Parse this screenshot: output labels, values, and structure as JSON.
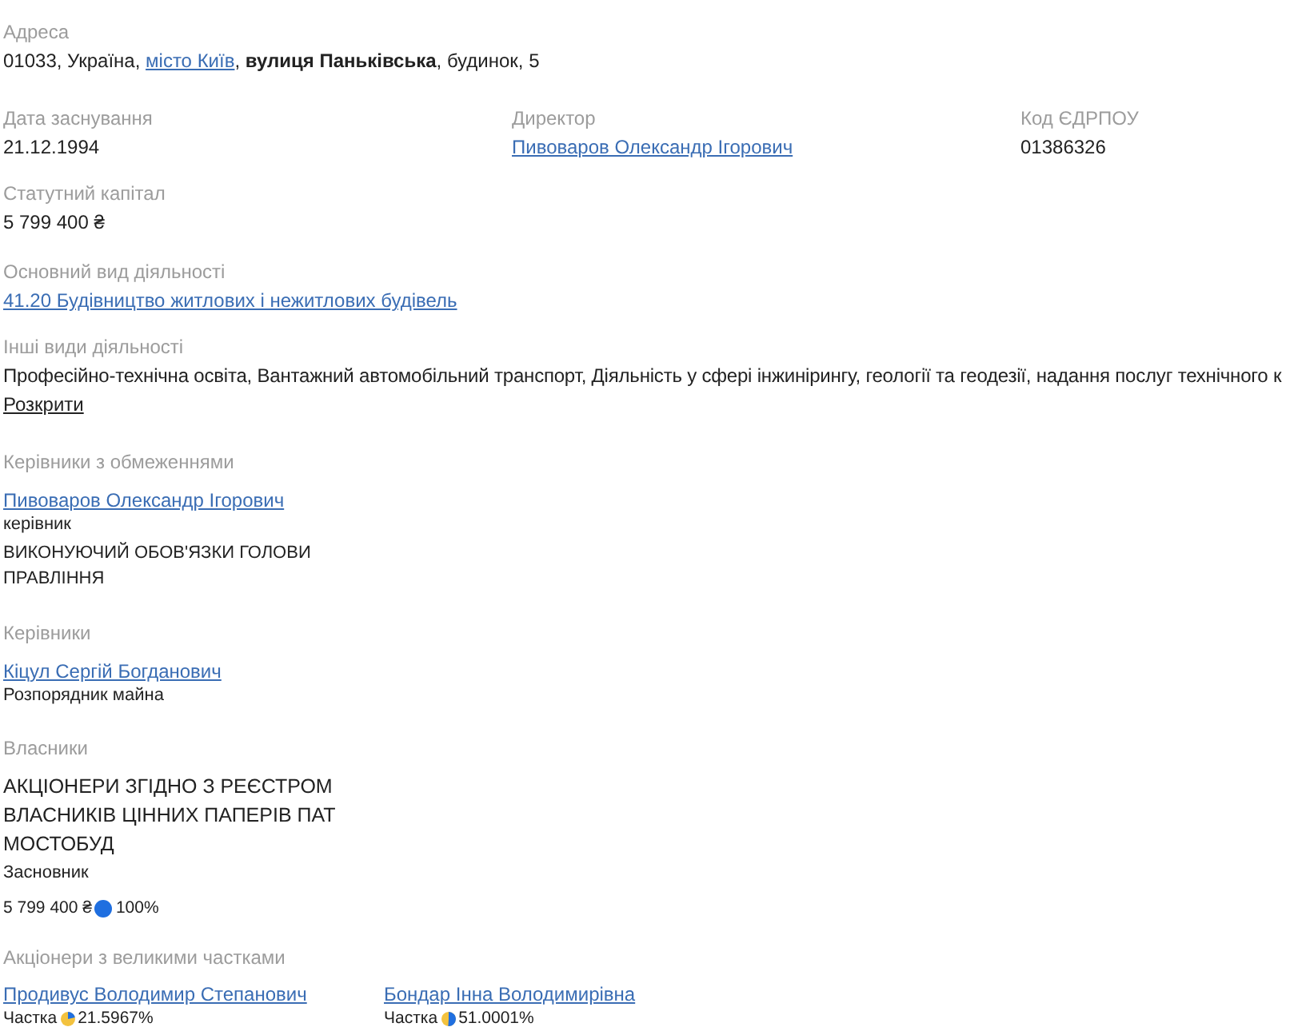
{
  "address": {
    "label": "Адреса",
    "parts": [
      {
        "kind": "text",
        "text": "01033, Україна, "
      },
      {
        "kind": "link",
        "text": "місто Київ"
      },
      {
        "kind": "text",
        "text": ", **вулиця Паньківська**, будинок, 5"
      }
    ]
  },
  "details": [
    {
      "label": "Дата заснування",
      "value": "21.12.1994",
      "kind": "text"
    },
    {
      "label": "Директор",
      "value": "Пивоваров Олександр Ігорович",
      "kind": "link"
    },
    {
      "label": "Код ЄДРПОУ",
      "value": "01386326",
      "kind": "text"
    }
  ],
  "capital": {
    "label": "Статутний капітал",
    "value": "5 799 400 ₴"
  },
  "main_activity": {
    "label": "Основний вид діяльності",
    "value": "41.20 Будівництво житлових і нежитлових будівель"
  },
  "other_activities": {
    "label": "Інші види діяльності",
    "value": "Професійно-технічна освіта, Вантажний автомобільний транспорт, Діяльність у сфері інжинірингу, геології та геодезії, надання послуг технічного к",
    "expand_link": "Розкрити"
  },
  "restricted_managers": {
    "title": "Керівники з обмеженнями",
    "people": [
      {
        "name": "Пивоваров Олександр Ігорович",
        "role": "керівник",
        "position": "ВИКОНУЮЧИЙ ОБОВ'ЯЗКИ ГОЛОВИ ПРАВЛІННЯ"
      }
    ]
  },
  "managers": {
    "title": "Керівники",
    "people": [
      {
        "name": "Кіцул Сергій Богданович",
        "role": "Розпорядник майна"
      }
    ]
  },
  "owners": {
    "title": "Власники",
    "items": [
      {
        "name": "АКЦІОНЕРИ ЗГІДНО З РЕЄСТРОМ ВЛАСНИКІВ ЦІННИХ ПАПЕРІВ ПАТ МОСТОБУД",
        "role": "Засновник",
        "amount": "5 799 400 ₴",
        "share": "100%"
      }
    ]
  },
  "major_shareholders": {
    "title": "Акціонери з великими частками",
    "items": [
      {
        "name": "Продивус Володимир Степанович",
        "share_label": "Частка",
        "share": "21.5967%"
      },
      {
        "name": "Бондар Інна Володимирівна",
        "share_label": "Частка",
        "share": "51.0001%"
      }
    ]
  }
}
